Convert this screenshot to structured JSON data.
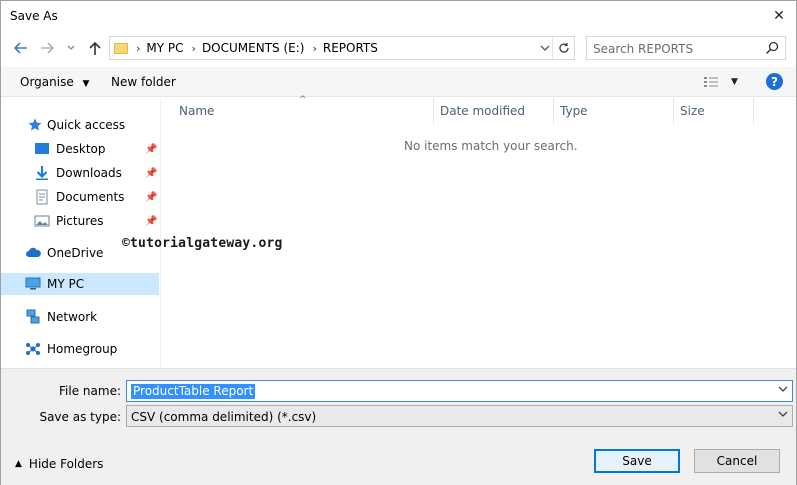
{
  "window": {
    "title": "Save As",
    "close_glyph": "✕"
  },
  "nav": {
    "breadcrumbs": [
      "MY PC",
      "DOCUMENTS (E:)",
      "REPORTS"
    ],
    "search_placeholder": "Search REPORTS"
  },
  "toolbar": {
    "organise_label": "Organise",
    "new_folder_label": "New folder",
    "help_label": "?"
  },
  "sidebar": {
    "items": [
      {
        "label": "Quick access",
        "icon": "star-icon"
      },
      {
        "label": "Desktop",
        "icon": "desktop-icon",
        "pinned": true
      },
      {
        "label": "Downloads",
        "icon": "download-icon",
        "pinned": true
      },
      {
        "label": "Documents",
        "icon": "documents-icon",
        "pinned": true
      },
      {
        "label": "Pictures",
        "icon": "pictures-icon",
        "pinned": true
      },
      {
        "label": "OneDrive",
        "icon": "cloud-icon"
      },
      {
        "label": "MY PC",
        "icon": "computer-icon",
        "selected": true
      },
      {
        "label": "Network",
        "icon": "network-icon"
      },
      {
        "label": "Homegroup",
        "icon": "homegroup-icon"
      }
    ]
  },
  "filelist": {
    "columns": [
      "Name",
      "Date modified",
      "Type",
      "Size"
    ],
    "empty_message": "No items match your search.",
    "watermark": "©tutorialgateway.org"
  },
  "form": {
    "filename_label": "File name:",
    "filename_value": "ProductTable Report",
    "savetype_label": "Save as type:",
    "savetype_value": "CSV (comma delimited) (*.csv)"
  },
  "footer": {
    "hide_folders_label": "Hide Folders",
    "save_label": "Save",
    "cancel_label": "Cancel"
  },
  "colors": {
    "accent": "#0078d7",
    "selection": "#cce8ff",
    "highlight": "#3390ff"
  }
}
